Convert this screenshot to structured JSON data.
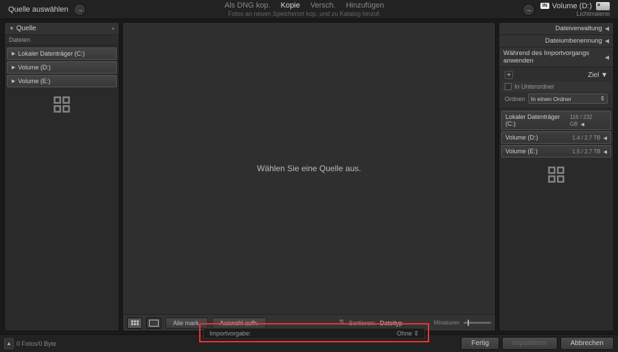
{
  "header": {
    "source_title": "Quelle auswählen",
    "modes": {
      "dng": "Als DNG kop.",
      "copy": "Kopie",
      "move": "Versch.",
      "add": "Hinzufügen"
    },
    "subtitle": "Fotos an neuen Speicherort kop. und zu Katalog hinzuf.",
    "dest_badge": "IN",
    "dest_title": "Volume (D:)",
    "dest_sub": "Lichtmalerei"
  },
  "left": {
    "panel": "Quelle",
    "section": "Dateien",
    "drives": [
      "Lokaler Datenträger (C:)",
      "Volume (D:)",
      "Volume (E:)"
    ]
  },
  "right": {
    "panels": [
      "Dateiverwaltung",
      "Dateiumbenennung",
      "Während des Importvorgangs anwenden"
    ],
    "ziel": "Ziel",
    "subfolder": "In Unterordner",
    "organize_label": "Ordnen",
    "organize_value": "In einen Ordner",
    "dests": [
      {
        "name": "Lokaler Datenträger (C:)",
        "size": "116 / 232 GB"
      },
      {
        "name": "Volume (D:)",
        "size": "1,4 / 2,7 TB"
      },
      {
        "name": "Volume (E:)",
        "size": "1,5 / 2,7 TB"
      }
    ]
  },
  "center": {
    "empty": "Wählen Sie eine Quelle aus.",
    "mark_all": "Alle mark.",
    "unmark": "Auswahl aufh.",
    "sort_label": "Sortieren:",
    "sort_value": "Dateityp",
    "thumb_label": "Miniaturen"
  },
  "footer": {
    "status": "0 Fotos/0 Byte",
    "preset_label": "Importvorgabe:",
    "preset_value": "Ohne",
    "done": "Fertig",
    "import": "Importieren",
    "cancel": "Abbrechen"
  }
}
